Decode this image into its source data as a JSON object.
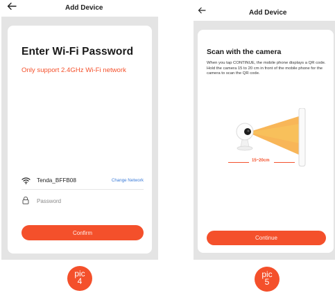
{
  "colors": {
    "accent": "#f4502b",
    "link": "#3b7bd8",
    "phone_bg": "#e4e4e4",
    "card_bg": "#ffffff"
  },
  "screen_left": {
    "header": {
      "back_icon": "arrow-left-icon",
      "title": "Add Device"
    },
    "title": "Enter Wi-Fi Password",
    "subtitle": "Only support 2.4GHz Wi-Fi network",
    "wifi": {
      "icon": "wifi-icon",
      "ssid": "Tenda_BFFB08",
      "change_label": "Change Network"
    },
    "password": {
      "icon": "lock-icon",
      "placeholder": "Password",
      "value": ""
    },
    "confirm_label": "Confirm"
  },
  "screen_right": {
    "header": {
      "back_icon": "arrow-left-icon",
      "title": "Add Device"
    },
    "title": "Scan with the camera",
    "description": "When you tap CONTINUE, the mobile phone displays a QR code. Hold the camera 15 to 20 cm in front of the mobile phone for the camera to scan the QR code.",
    "distance_label": "15~20cm",
    "continue_label": "Continue"
  },
  "badges": {
    "left": {
      "line1": "pic",
      "line2": "4"
    },
    "right": {
      "line1": "pic",
      "line2": "5"
    }
  }
}
